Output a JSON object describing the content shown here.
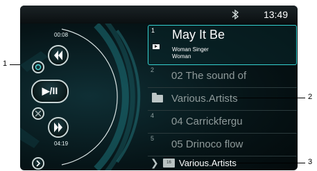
{
  "status_bar": {
    "clock": "13:49",
    "bluetooth_icon": "bluetooth-icon"
  },
  "player": {
    "elapsed": "00:08",
    "total": "04:19",
    "controls": {
      "repeat_icon": "repeat-icon",
      "prev_icon": "skip-back-icon",
      "play_pause_label": "▶/II",
      "shuffle_icon": "shuffle-icon",
      "next_icon": "skip-forward-icon",
      "more_icon": "chevron-right-icon"
    }
  },
  "tracklist": {
    "items": [
      {
        "num": "1",
        "title": "May It Be",
        "artist": "Woman Singer",
        "album": "Woman",
        "current": true
      },
      {
        "num": "2",
        "title": "02 The sound of"
      },
      {
        "num": "",
        "title": "Various.Artists",
        "folder": true
      },
      {
        "num": "4",
        "title": "04 Carrickfergu"
      },
      {
        "num": "5",
        "title": "05 Drinoco flow"
      }
    ]
  },
  "breadcrumb": {
    "badge": "16",
    "text": "Various.Artists"
  },
  "callouts": {
    "c1": "1",
    "c2": "2",
    "c3": "3"
  },
  "colors": {
    "accent": "#35d1d0",
    "background": "#061417",
    "text": "#ffffff"
  }
}
